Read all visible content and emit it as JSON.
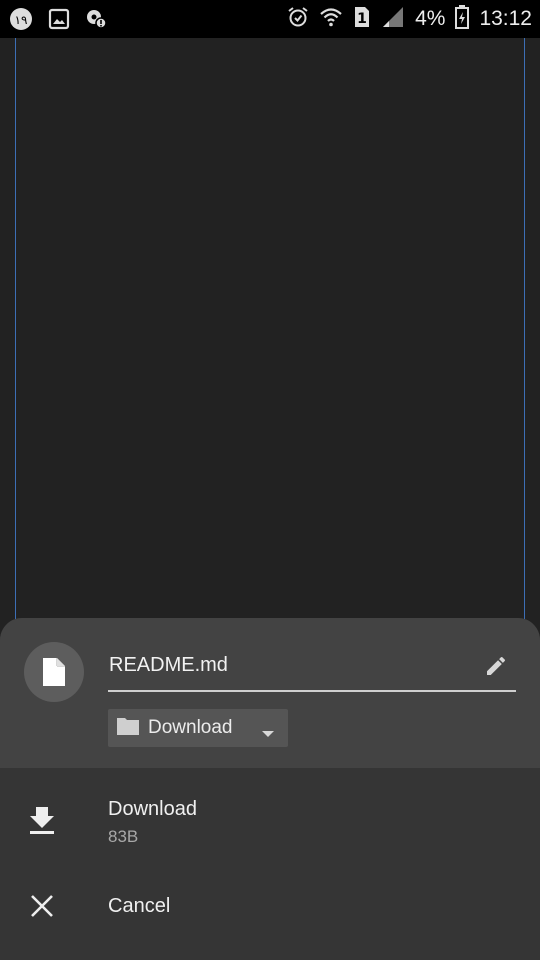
{
  "status_bar": {
    "notification_badge": "۱۹",
    "battery_percent": "4%",
    "clock": "13:12",
    "sim_label": "1",
    "icons": [
      "notification-badge-icon",
      "image-icon",
      "location-icon",
      "alarm-icon",
      "wifi-icon",
      "sim-1-icon",
      "signal-icon",
      "battery-icon"
    ]
  },
  "sheet": {
    "filename": "README.md",
    "folder": "Download",
    "actions": [
      {
        "label": "Download",
        "sub": "83B",
        "icon": "download-icon"
      },
      {
        "label": "Cancel",
        "icon": "close-icon"
      }
    ]
  },
  "colors": {
    "sheet_bg": "#353535",
    "header_bg": "#434343",
    "app_bg": "#222222",
    "edge_line": "#3d6fb6"
  }
}
